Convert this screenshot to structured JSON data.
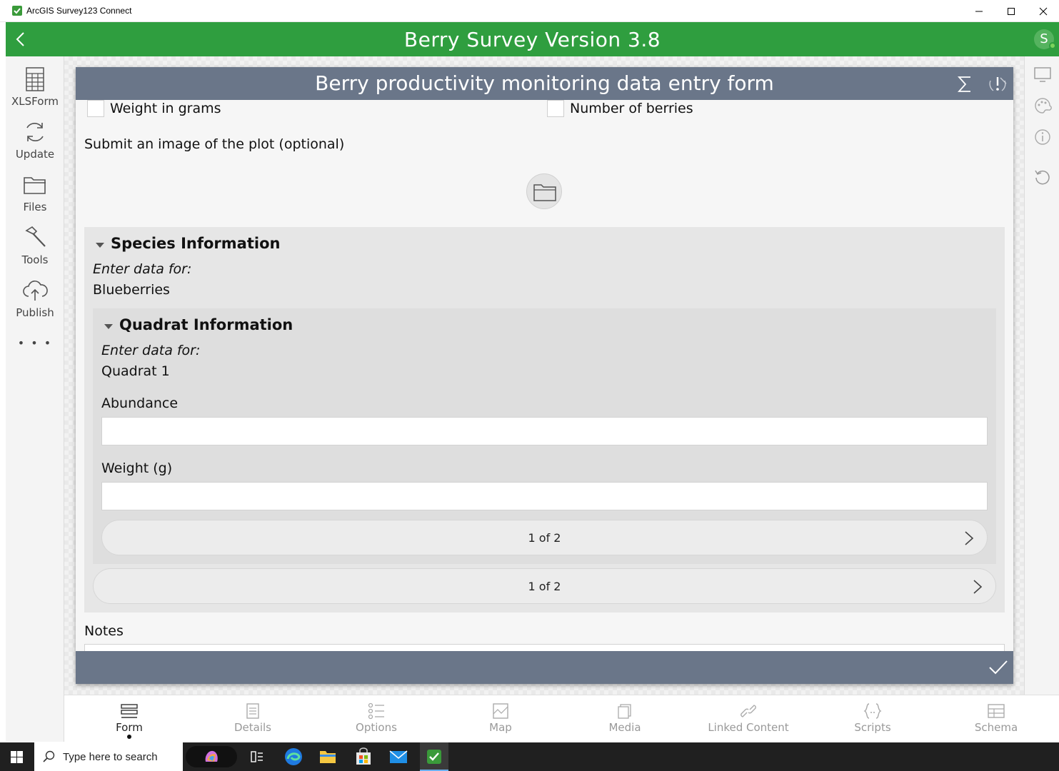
{
  "window": {
    "title": "ArcGIS Survey123 Connect"
  },
  "header": {
    "title": "Berry Survey Version 3.8",
    "avatar_initial": "S"
  },
  "sidebar": {
    "items": [
      {
        "label": "XLSForm",
        "icon": "spreadsheet-icon"
      },
      {
        "label": "Update",
        "icon": "refresh-icon"
      },
      {
        "label": "Files",
        "icon": "folder-icon"
      },
      {
        "label": "Tools",
        "icon": "hammer-icon"
      },
      {
        "label": "Publish",
        "icon": "cloud-upload-icon"
      },
      {
        "label": "• • •",
        "icon": "more-icon"
      }
    ]
  },
  "form": {
    "title": "Berry productivity monitoring data entry form",
    "option_weight": "Weight in grams",
    "option_berries": "Number of berries",
    "image_label": "Submit an image of the plot (optional)",
    "species": {
      "title": "Species Information",
      "hint": "Enter data for:",
      "value": "Blueberries",
      "pager": "1 of 2"
    },
    "quadrat": {
      "title": "Quadrat Information",
      "hint": "Enter data for:",
      "value": "Quadrat 1",
      "abundance_label": "Abundance",
      "abundance_value": "",
      "weight_label": "Weight (g)",
      "weight_value": "",
      "pager": "1 of 2"
    },
    "notes_label": "Notes"
  },
  "tabs": [
    {
      "label": "Form",
      "icon": "form-icon",
      "active": true
    },
    {
      "label": "Details",
      "icon": "details-icon",
      "active": false
    },
    {
      "label": "Options",
      "icon": "options-icon",
      "active": false
    },
    {
      "label": "Map",
      "icon": "map-icon",
      "active": false
    },
    {
      "label": "Media",
      "icon": "media-icon",
      "active": false
    },
    {
      "label": "Linked Content",
      "icon": "link-icon",
      "active": false
    },
    {
      "label": "Scripts",
      "icon": "scripts-icon",
      "active": false
    },
    {
      "label": "Schema",
      "icon": "schema-icon",
      "active": false
    }
  ],
  "taskbar": {
    "search_placeholder": "Type here to search"
  },
  "colors": {
    "header_green": "#2f9e3f",
    "form_header": "#6a7689"
  }
}
